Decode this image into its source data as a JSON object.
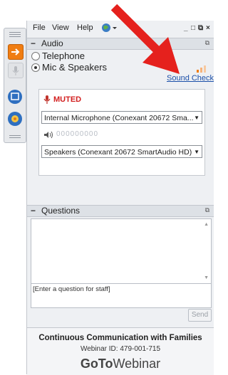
{
  "menu": {
    "file": "File",
    "view": "View",
    "help": "Help"
  },
  "window_controls": {
    "minimize": "_",
    "restore": "□",
    "popout": "⧉",
    "close": "×"
  },
  "audio": {
    "title": "Audio",
    "options": [
      {
        "label": "Telephone",
        "selected": false
      },
      {
        "label": "Mic & Speakers",
        "selected": true
      }
    ],
    "sound_check": "Sound Check",
    "muted": "MUTED",
    "mic_level": "000000000",
    "microphone": "Internal Microphone (Conexant 20672 Sma...",
    "speakers": "Speakers (Conexant 20672 SmartAudio HD)"
  },
  "questions": {
    "title": "Questions",
    "placeholder": "[Enter a question for staff]",
    "send": "Send"
  },
  "webinar": {
    "title": "Continuous Communication with Families",
    "id_label": "Webinar ID:",
    "id": "479-001-715",
    "brand_goto": "GoTo",
    "brand_webinar": "Webinar"
  },
  "colors": {
    "muted_red": "#d32121",
    "link_blue": "#1a4fa8",
    "arrow_red": "#e5211d",
    "orange": "#f07d12",
    "sidebar_blue": "#2e6fc0"
  }
}
